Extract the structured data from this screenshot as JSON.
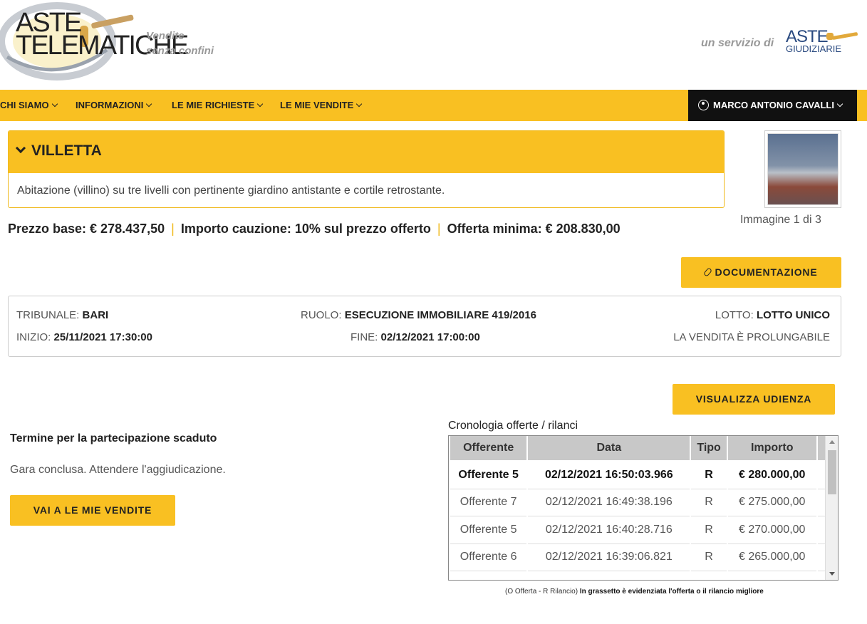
{
  "header": {
    "logo_line1": "ASTE",
    "logo_line2": "TELEMATICHE",
    "tagline_1": "Vendite",
    "tagline_2": "senza confini",
    "service_text": "un servizio di",
    "partner_line1": "ASTE",
    "partner_line2": "GIUDIZIARIE"
  },
  "nav": {
    "items": [
      "CHI SIAMO",
      "INFORMAZIONI",
      "LE MIE RICHIESTE",
      "LE MIE VENDITE"
    ],
    "user": "MARCO ANTONIO CAVALLI"
  },
  "lot": {
    "title": "VILLETTA",
    "description": "Abitazione (villino) su tre livelli con pertinente giardino antistante e cortile retrostante.",
    "image_caption": "Immagine 1 di 3"
  },
  "prices": {
    "base": "Prezzo base: € 278.437,50",
    "deposit": "Importo cauzione: 10% sul prezzo offerto",
    "minimum": "Offerta minima: € 208.830,00",
    "sep": "|"
  },
  "buttons": {
    "documentation": "DOCUMENTAZIONE",
    "hearing": "VISUALIZZA UDIENZA",
    "my_sales": "VAI A LE MIE VENDITE"
  },
  "info": {
    "tribunale_label": "TRIBUNALE:",
    "tribunale_value": "BARI",
    "ruolo_label": "RUOLO:",
    "ruolo_value": "ESECUZIONE IMMOBILIARE 419/2016",
    "lotto_label": "LOTTO:",
    "lotto_value": "LOTTO UNICO",
    "inizio_label": "INIZIO:",
    "inizio_value": "25/11/2021 17:30:00",
    "fine_label": "FINE:",
    "fine_value": "02/12/2021 17:00:00",
    "prolungabile": "LA VENDITA È PROLUNGABILE"
  },
  "status": {
    "title": "Termine per la partecipazione scaduto",
    "message": "Gara conclusa. Attendere l'aggiudicazione."
  },
  "bids": {
    "title": "Cronologia offerte / rilanci",
    "headers": [
      "Offerente",
      "Data",
      "Tipo",
      "Importo"
    ],
    "rows": [
      [
        "Offerente 5",
        "02/12/2021 16:50:03.966",
        "R",
        "€ 280.000,00"
      ],
      [
        "Offerente 7",
        "02/12/2021 16:49:38.196",
        "R",
        "€ 275.000,00"
      ],
      [
        "Offerente 5",
        "02/12/2021 16:40:28.716",
        "R",
        "€ 270.000,00"
      ],
      [
        "Offerente 6",
        "02/12/2021 16:39:06.821",
        "R",
        "€ 265.000,00"
      ]
    ],
    "legend_plain": "(O Offerta - R Rilancio)",
    "legend_bold": "In grassetto è evidenziata l'offerta o il rilancio migliore"
  },
  "colors": {
    "accent": "#f9c022",
    "dark": "#111111"
  }
}
